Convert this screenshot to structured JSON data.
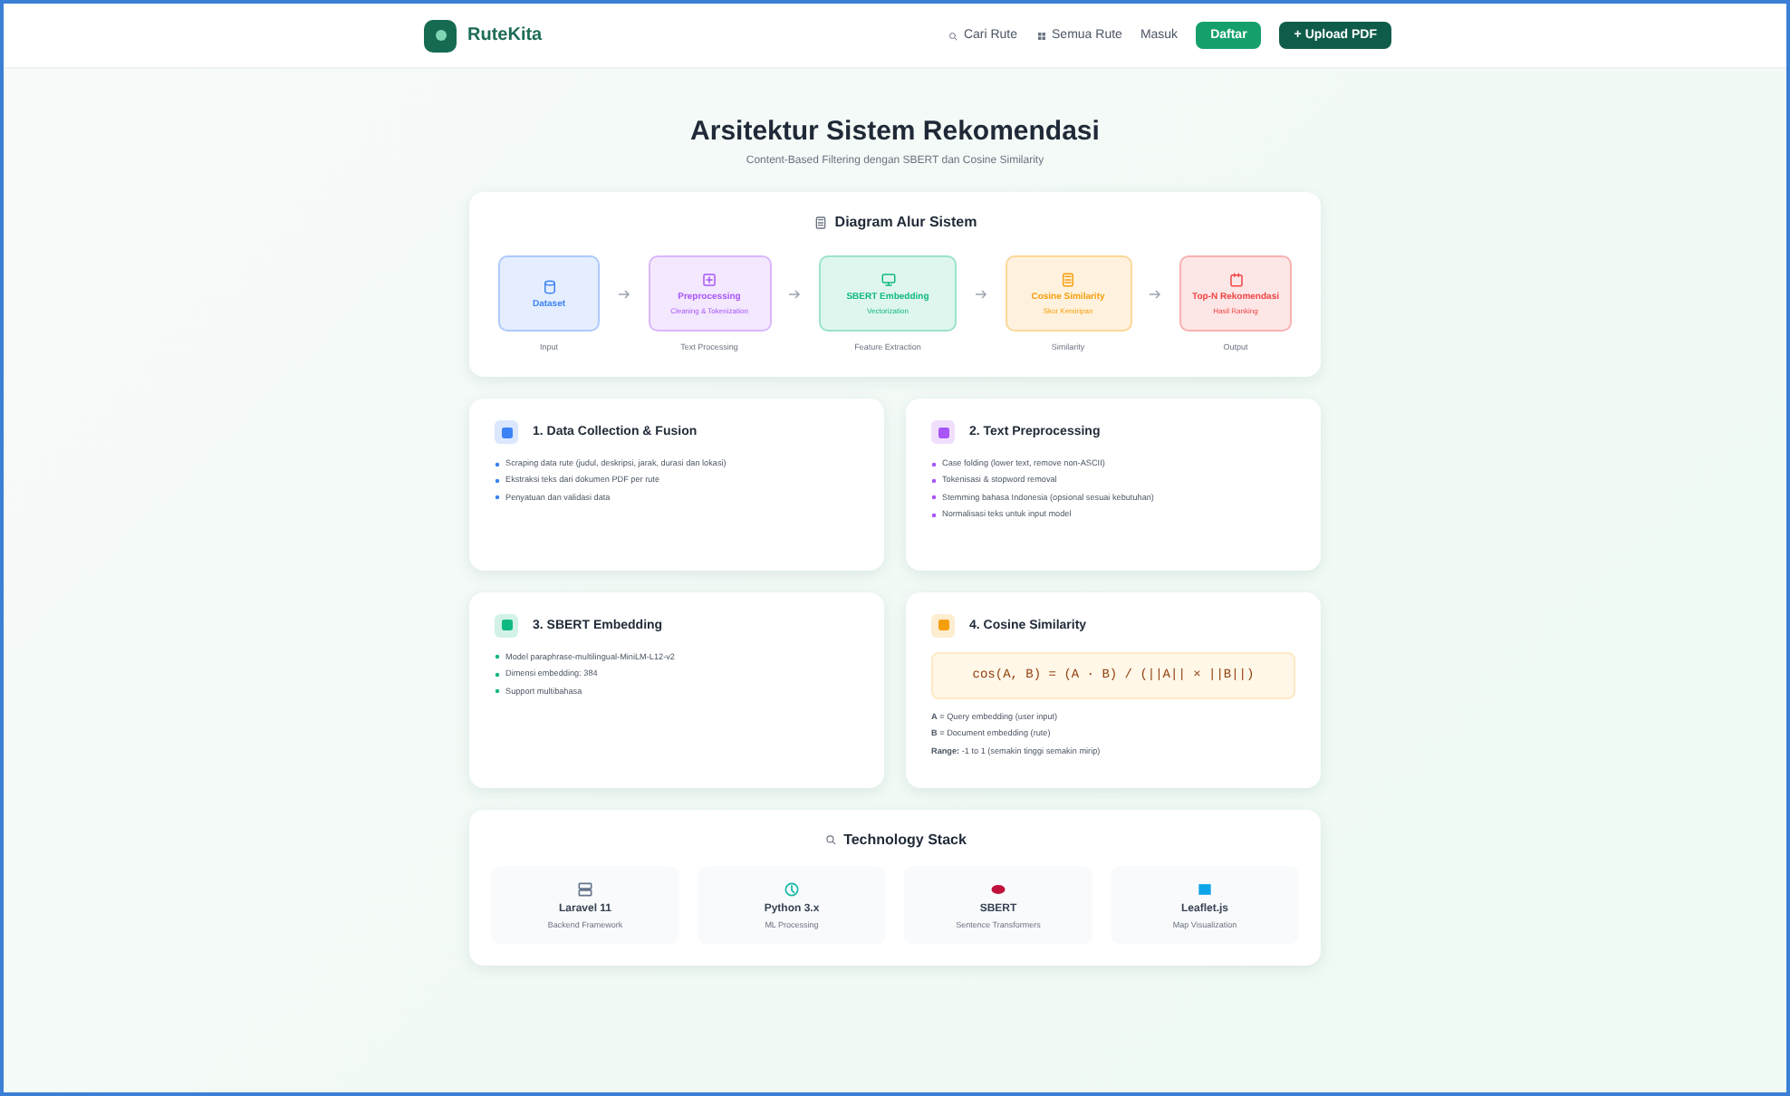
{
  "brand": {
    "name": "RuteKita"
  },
  "nav": {
    "links": [
      {
        "label": "Cari Rute"
      },
      {
        "label": "Semua Rute"
      },
      {
        "label": "Masuk"
      }
    ],
    "buttons": [
      {
        "kind": "primary",
        "label": "Daftar"
      },
      {
        "kind": "dark",
        "label": "+ Upload PDF"
      }
    ]
  },
  "header": {
    "title": "Arsitektur Sistem Rekomendasi",
    "subtitle": "Content-Based Filtering dengan SBERT dan Cosine Similarity"
  },
  "diagram": {
    "title": "Diagram Alur Sistem",
    "nodes": [
      {
        "title": "Dataset",
        "caption": "Input",
        "color": "#3b82f6"
      },
      {
        "title": "Preprocessing",
        "subtitle": "Cleaning & Tokenization",
        "caption": "Text Processing",
        "color": "#a855f7"
      },
      {
        "title": "SBERT Embedding",
        "subtitle": "Vectorization",
        "caption": "Feature Extraction",
        "color": "#10b981"
      },
      {
        "title": "Cosine Similarity",
        "subtitle": "Skor Kemiripan",
        "caption": "Similarity",
        "color": "#f59e0b"
      },
      {
        "title": "Top-N Rekomendasi",
        "subtitle": "Hasil Ranking",
        "caption": "Output",
        "color": "#ef4444"
      }
    ]
  },
  "steps": [
    {
      "title": "1. Data Collection & Fusion",
      "color": "#3b82f6",
      "kind": "list",
      "items": [
        "Scraping data rute (judul, deskripsi, jarak, durasi dan lokasi)",
        "Ekstraksi teks dari dokumen PDF per rute",
        "Penyatuan dan validasi data"
      ]
    },
    {
      "title": "2. Text Preprocessing",
      "color": "#a855f7",
      "kind": "list",
      "items": [
        "Case folding (lower text, remove non-ASCII)",
        "Tokenisasi & stopword removal",
        "Stemming bahasa Indonesia (opsional sesuai kebutuhan)",
        "Normalisasi teks untuk input model"
      ]
    },
    {
      "title": "3. SBERT Embedding",
      "color": "#10b981",
      "kind": "list",
      "items": [
        "Model paraphrase-multilingual-MiniLM-L12-v2",
        "Dimensi embedding: 384",
        "Support multibahasa"
      ]
    },
    {
      "title": "4. Cosine Similarity",
      "color": "#f59e0b",
      "kind": "formula",
      "formula": "cos(A, B) = (A · B) / (||A|| × ||B||)",
      "items": [
        "**A** = Query embedding (user input)",
        "**B** = Document embedding (rute)",
        "**Range:** -1 to 1 (semakin tinggi semakin mirip)"
      ]
    }
  ],
  "tech": {
    "title": "Technology Stack",
    "items": [
      {
        "name": "Laravel 11",
        "desc": "Backend Framework",
        "color": "#64748b"
      },
      {
        "name": "Python 3.x",
        "desc": "ML Processing",
        "color": "#14b8a6"
      },
      {
        "name": "SBERT",
        "desc": "Sentence Transformers",
        "color": "#be123c"
      },
      {
        "name": "Leaflet.js",
        "desc": "Map Visualization",
        "color": "#0ea5e9"
      }
    ]
  }
}
